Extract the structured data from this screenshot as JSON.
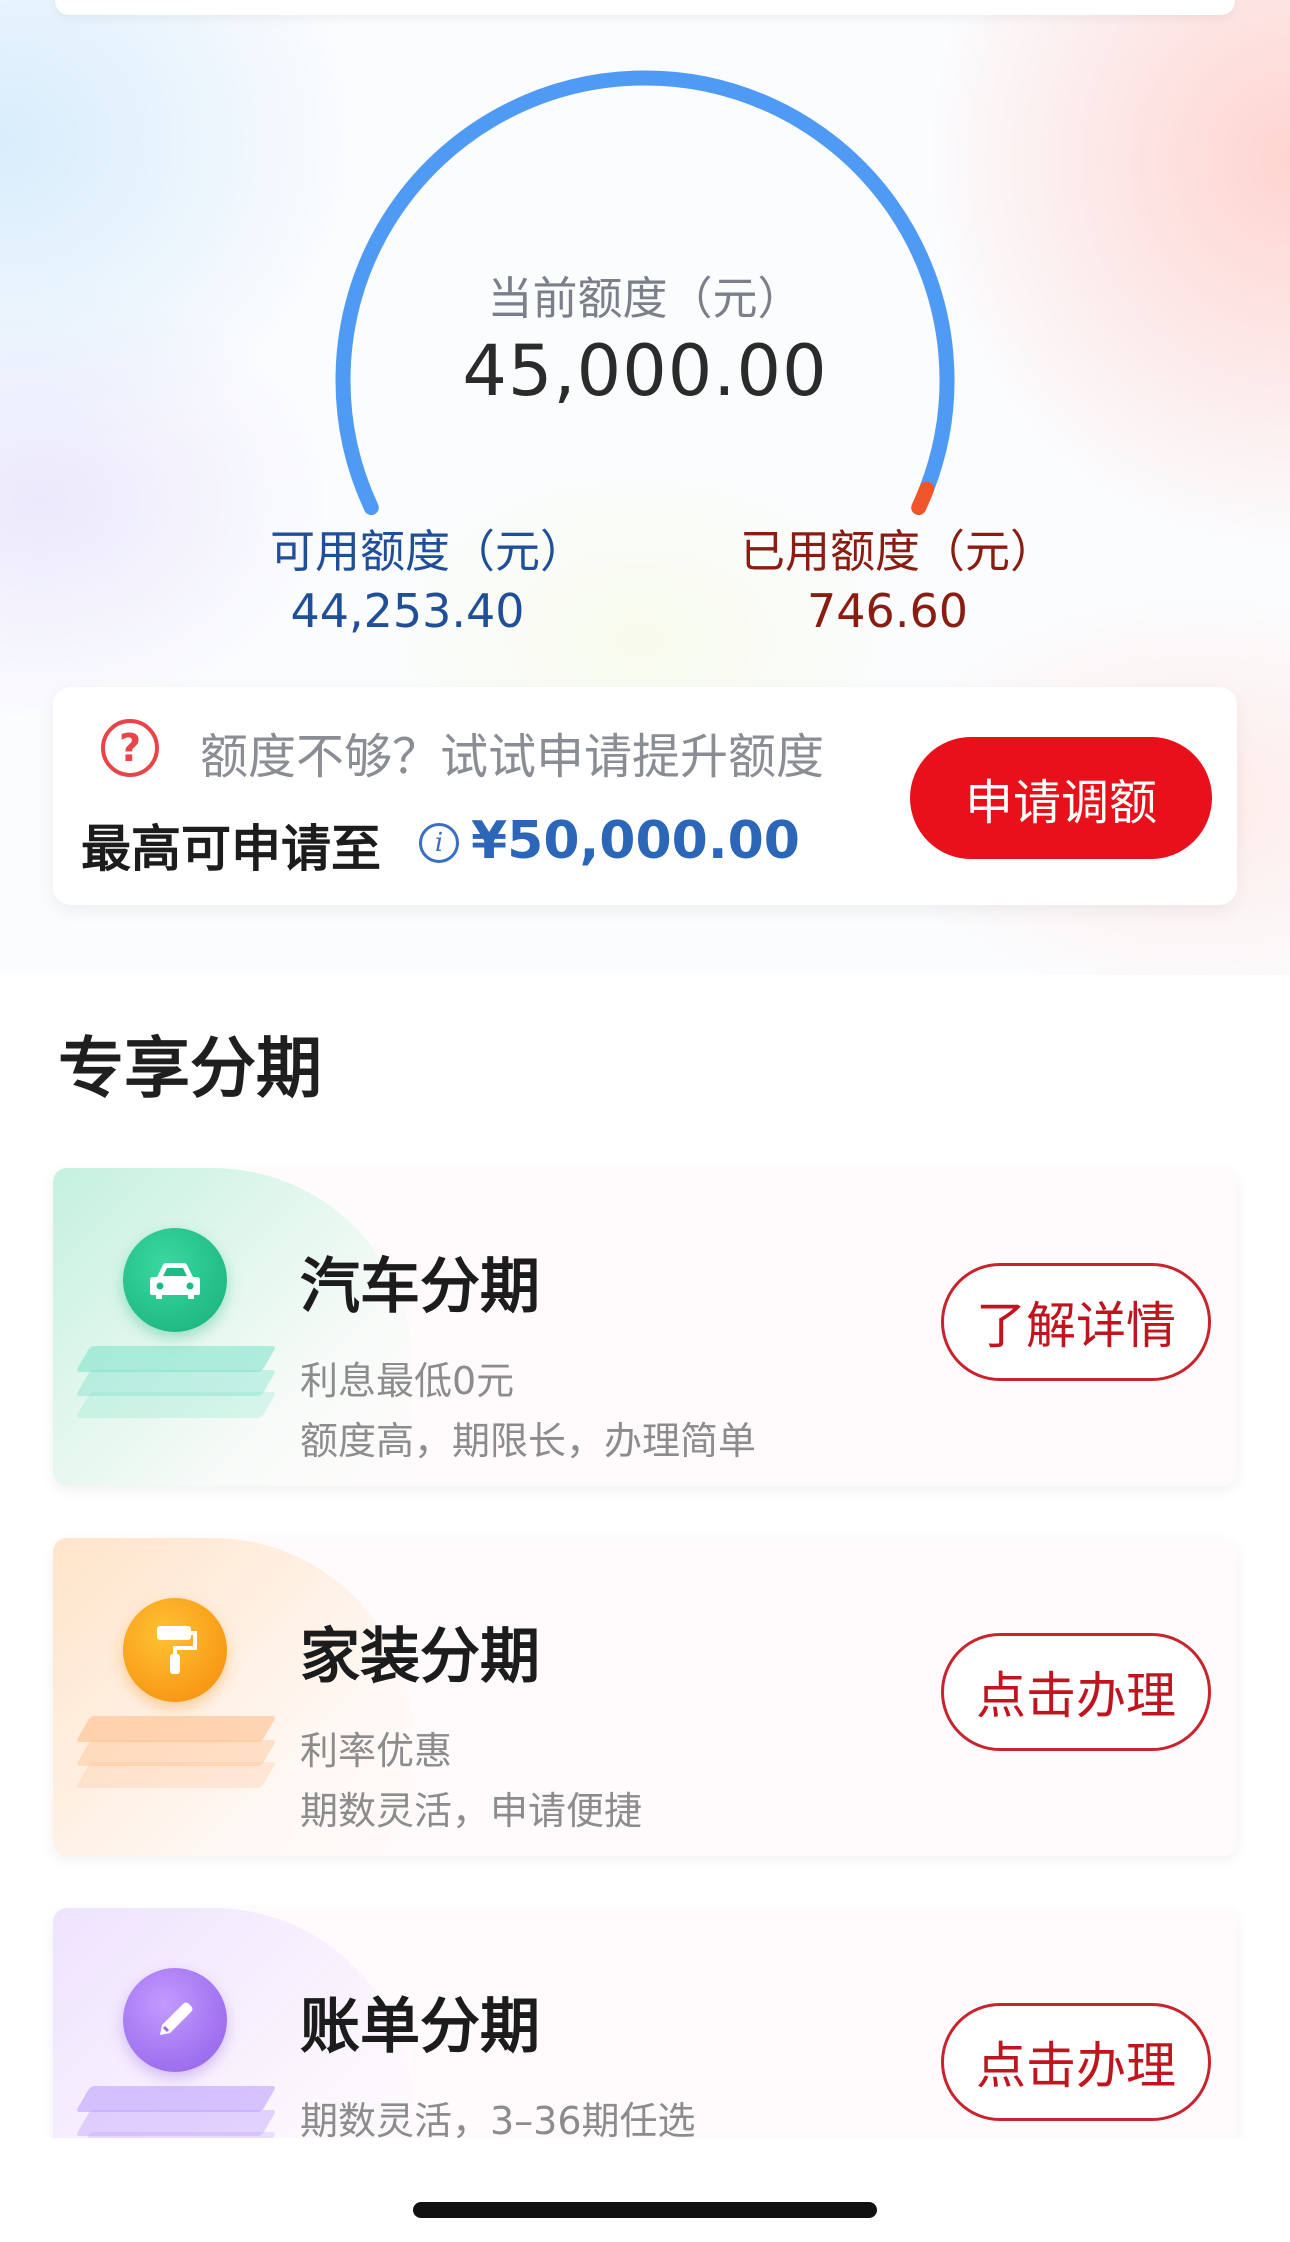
{
  "colors": {
    "gauge_blue": "#4f9bf3",
    "gauge_orange": "#f0562a",
    "accent_red": "#e8101a",
    "available_blue": "#1f4f98",
    "used_red": "#8a1d12",
    "max_amount_blue": "#2b66b8"
  },
  "credit": {
    "current_label": "当前额度（元）",
    "current_value": "45,000.00",
    "used_fraction": 0.0166,
    "available_label": "可用额度（元）",
    "available_value": "44,253.40",
    "used_label": "已用额度（元）",
    "used_value": "746.60"
  },
  "raise": {
    "question_icon": "question-circle-icon",
    "tip": "额度不够？试试申请提升额度",
    "max_label": "最高可申请至",
    "info_icon": "info-circle-icon",
    "max_amount": "¥50,000.00",
    "button_label": "申请调额"
  },
  "section": {
    "title": "专享分期"
  },
  "products": [
    {
      "icon": "car-icon",
      "title": "汽车分期",
      "line1": "利息最低0元",
      "line2": "额度高，期限长，办理简单",
      "button": "了解详情"
    },
    {
      "icon": "paint-roller-icon",
      "title": "家装分期",
      "line1": "利率优惠",
      "line2": "期数灵活，申请便捷",
      "button": "点击办理"
    },
    {
      "icon": "pencil-icon",
      "title": "账单分期",
      "line1": "期数灵活，3–36期任选",
      "line2": "",
      "button": "点击办理"
    }
  ]
}
